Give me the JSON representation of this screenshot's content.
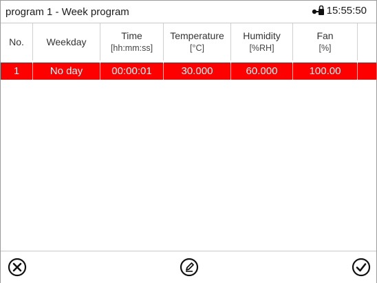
{
  "header": {
    "title": "program 1 - Week program",
    "time": "15:55:50",
    "lock_icon": "lock-key-icon"
  },
  "table": {
    "columns": [
      {
        "label": "No.",
        "sub": ""
      },
      {
        "label": "Weekday",
        "sub": ""
      },
      {
        "label": "Time",
        "sub": "[hh:mm:ss]"
      },
      {
        "label": "Temperature",
        "sub": "[°C]"
      },
      {
        "label": "Humidity",
        "sub": "[%RH]"
      },
      {
        "label": "Fan",
        "sub": "[%]"
      }
    ],
    "rows": [
      {
        "no": "1",
        "weekday": "No day",
        "time": "00:00:01",
        "temperature": "30.000",
        "humidity": "60.000",
        "fan": "100.00"
      }
    ],
    "selected_row_color": "#ff0000"
  },
  "footer": {
    "cancel_icon": "close-circle-icon",
    "edit_icon": "pencil-circle-icon",
    "confirm_icon": "check-circle-icon"
  }
}
